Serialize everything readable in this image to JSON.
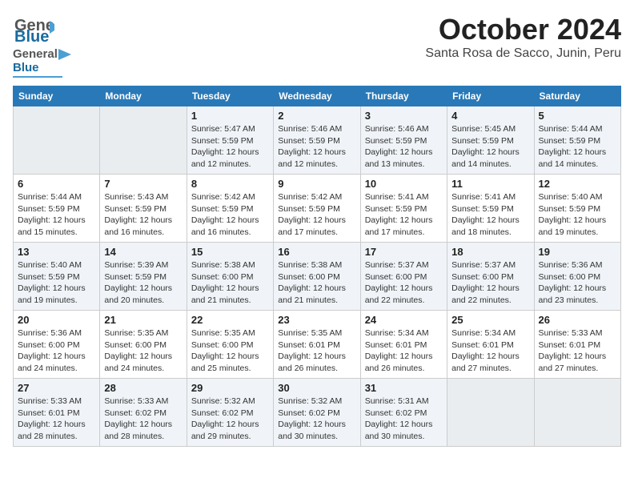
{
  "header": {
    "logo_general": "General",
    "logo_blue": "Blue",
    "month": "October 2024",
    "location": "Santa Rosa de Sacco, Junin, Peru"
  },
  "days_of_week": [
    "Sunday",
    "Monday",
    "Tuesday",
    "Wednesday",
    "Thursday",
    "Friday",
    "Saturday"
  ],
  "weeks": [
    [
      {
        "day": "",
        "info": ""
      },
      {
        "day": "",
        "info": ""
      },
      {
        "day": "1",
        "info": "Sunrise: 5:47 AM\nSunset: 5:59 PM\nDaylight: 12 hours\nand 12 minutes."
      },
      {
        "day": "2",
        "info": "Sunrise: 5:46 AM\nSunset: 5:59 PM\nDaylight: 12 hours\nand 12 minutes."
      },
      {
        "day": "3",
        "info": "Sunrise: 5:46 AM\nSunset: 5:59 PM\nDaylight: 12 hours\nand 13 minutes."
      },
      {
        "day": "4",
        "info": "Sunrise: 5:45 AM\nSunset: 5:59 PM\nDaylight: 12 hours\nand 14 minutes."
      },
      {
        "day": "5",
        "info": "Sunrise: 5:44 AM\nSunset: 5:59 PM\nDaylight: 12 hours\nand 14 minutes."
      }
    ],
    [
      {
        "day": "6",
        "info": "Sunrise: 5:44 AM\nSunset: 5:59 PM\nDaylight: 12 hours\nand 15 minutes."
      },
      {
        "day": "7",
        "info": "Sunrise: 5:43 AM\nSunset: 5:59 PM\nDaylight: 12 hours\nand 16 minutes."
      },
      {
        "day": "8",
        "info": "Sunrise: 5:42 AM\nSunset: 5:59 PM\nDaylight: 12 hours\nand 16 minutes."
      },
      {
        "day": "9",
        "info": "Sunrise: 5:42 AM\nSunset: 5:59 PM\nDaylight: 12 hours\nand 17 minutes."
      },
      {
        "day": "10",
        "info": "Sunrise: 5:41 AM\nSunset: 5:59 PM\nDaylight: 12 hours\nand 17 minutes."
      },
      {
        "day": "11",
        "info": "Sunrise: 5:41 AM\nSunset: 5:59 PM\nDaylight: 12 hours\nand 18 minutes."
      },
      {
        "day": "12",
        "info": "Sunrise: 5:40 AM\nSunset: 5:59 PM\nDaylight: 12 hours\nand 19 minutes."
      }
    ],
    [
      {
        "day": "13",
        "info": "Sunrise: 5:40 AM\nSunset: 5:59 PM\nDaylight: 12 hours\nand 19 minutes."
      },
      {
        "day": "14",
        "info": "Sunrise: 5:39 AM\nSunset: 5:59 PM\nDaylight: 12 hours\nand 20 minutes."
      },
      {
        "day": "15",
        "info": "Sunrise: 5:38 AM\nSunset: 6:00 PM\nDaylight: 12 hours\nand 21 minutes."
      },
      {
        "day": "16",
        "info": "Sunrise: 5:38 AM\nSunset: 6:00 PM\nDaylight: 12 hours\nand 21 minutes."
      },
      {
        "day": "17",
        "info": "Sunrise: 5:37 AM\nSunset: 6:00 PM\nDaylight: 12 hours\nand 22 minutes."
      },
      {
        "day": "18",
        "info": "Sunrise: 5:37 AM\nSunset: 6:00 PM\nDaylight: 12 hours\nand 22 minutes."
      },
      {
        "day": "19",
        "info": "Sunrise: 5:36 AM\nSunset: 6:00 PM\nDaylight: 12 hours\nand 23 minutes."
      }
    ],
    [
      {
        "day": "20",
        "info": "Sunrise: 5:36 AM\nSunset: 6:00 PM\nDaylight: 12 hours\nand 24 minutes."
      },
      {
        "day": "21",
        "info": "Sunrise: 5:35 AM\nSunset: 6:00 PM\nDaylight: 12 hours\nand 24 minutes."
      },
      {
        "day": "22",
        "info": "Sunrise: 5:35 AM\nSunset: 6:00 PM\nDaylight: 12 hours\nand 25 minutes."
      },
      {
        "day": "23",
        "info": "Sunrise: 5:35 AM\nSunset: 6:01 PM\nDaylight: 12 hours\nand 26 minutes."
      },
      {
        "day": "24",
        "info": "Sunrise: 5:34 AM\nSunset: 6:01 PM\nDaylight: 12 hours\nand 26 minutes."
      },
      {
        "day": "25",
        "info": "Sunrise: 5:34 AM\nSunset: 6:01 PM\nDaylight: 12 hours\nand 27 minutes."
      },
      {
        "day": "26",
        "info": "Sunrise: 5:33 AM\nSunset: 6:01 PM\nDaylight: 12 hours\nand 27 minutes."
      }
    ],
    [
      {
        "day": "27",
        "info": "Sunrise: 5:33 AM\nSunset: 6:01 PM\nDaylight: 12 hours\nand 28 minutes."
      },
      {
        "day": "28",
        "info": "Sunrise: 5:33 AM\nSunset: 6:02 PM\nDaylight: 12 hours\nand 28 minutes."
      },
      {
        "day": "29",
        "info": "Sunrise: 5:32 AM\nSunset: 6:02 PM\nDaylight: 12 hours\nand 29 minutes."
      },
      {
        "day": "30",
        "info": "Sunrise: 5:32 AM\nSunset: 6:02 PM\nDaylight: 12 hours\nand 30 minutes."
      },
      {
        "day": "31",
        "info": "Sunrise: 5:31 AM\nSunset: 6:02 PM\nDaylight: 12 hours\nand 30 minutes."
      },
      {
        "day": "",
        "info": ""
      },
      {
        "day": "",
        "info": ""
      }
    ]
  ]
}
